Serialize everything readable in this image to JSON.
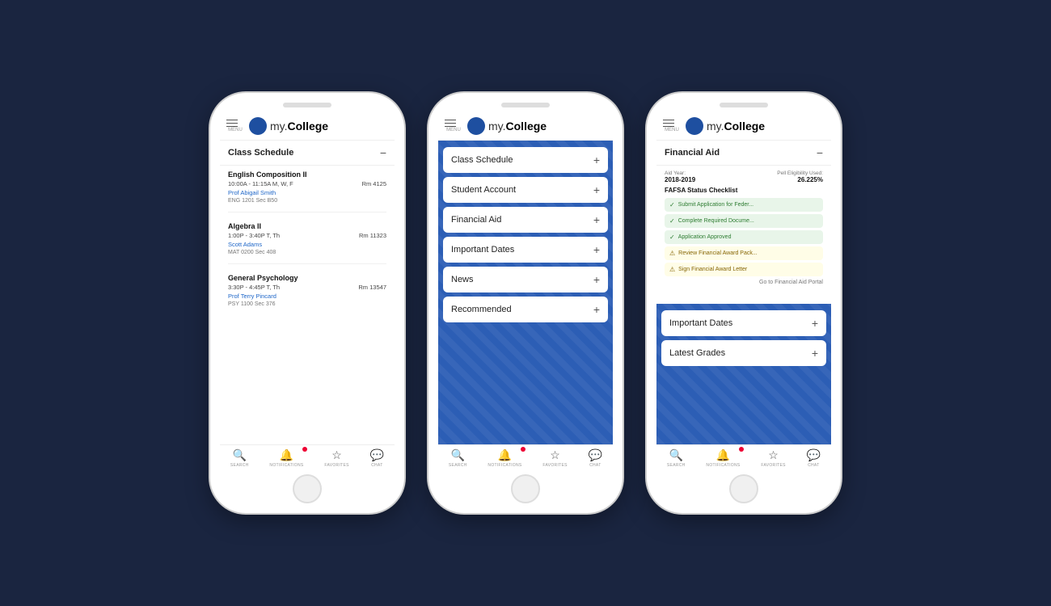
{
  "app": {
    "logo_text_my": "my.",
    "logo_text_college": "College",
    "menu_label": "MENU"
  },
  "nav": {
    "search": "SEARCH",
    "notifications": "NOTIFICATIONS",
    "favorites": "FAVORITES",
    "chat": "CHAT"
  },
  "phone1": {
    "header_title": "Class Schedule",
    "classes": [
      {
        "name": "English Composition II",
        "time": "10:00A - 11:15A  M, W, F",
        "room": "Rm 4125",
        "prof": "Prof Abigail Smith",
        "code": "ENG 1201   Sec B50"
      },
      {
        "name": "Algebra II",
        "time": "1:00P - 3:40P  T, Th",
        "room": "Rm 11323",
        "prof": "Scott Adams",
        "code": "MAT 0200   Sec 408"
      },
      {
        "name": "General Psychology",
        "time": "3:30P - 4:45P  T, Th",
        "room": "Rm 13547",
        "prof": "Prof Terry Pincard",
        "code": "PSY 1100   Sec 376"
      }
    ]
  },
  "phone2": {
    "accordion_items": [
      {
        "label": "Class Schedule"
      },
      {
        "label": "Student Account"
      },
      {
        "label": "Financial Aid"
      },
      {
        "label": "Important Dates"
      },
      {
        "label": "News"
      },
      {
        "label": "Recommended"
      }
    ]
  },
  "phone3": {
    "section_title": "Financial Aid",
    "aid_year_label": "Aid Year:",
    "aid_year_value": "2018-2019",
    "pell_label": "Pell Eligibility Used:",
    "pell_value": "26.225%",
    "fafsa_title": "FAFSA Status Checklist",
    "checklist": [
      {
        "text": "Submit Application for Feder...",
        "type": "green"
      },
      {
        "text": "Complete Required Docume...",
        "type": "green"
      },
      {
        "text": "Application Approved",
        "type": "green"
      },
      {
        "text": "Review Financial Award Pack...",
        "type": "yellow"
      },
      {
        "text": "Sign Financial Award Letter",
        "type": "yellow"
      }
    ],
    "portal_link": "Go to Financial Aid Portal",
    "bottom_items": [
      {
        "label": "Important Dates"
      },
      {
        "label": "Latest Grades"
      }
    ]
  }
}
